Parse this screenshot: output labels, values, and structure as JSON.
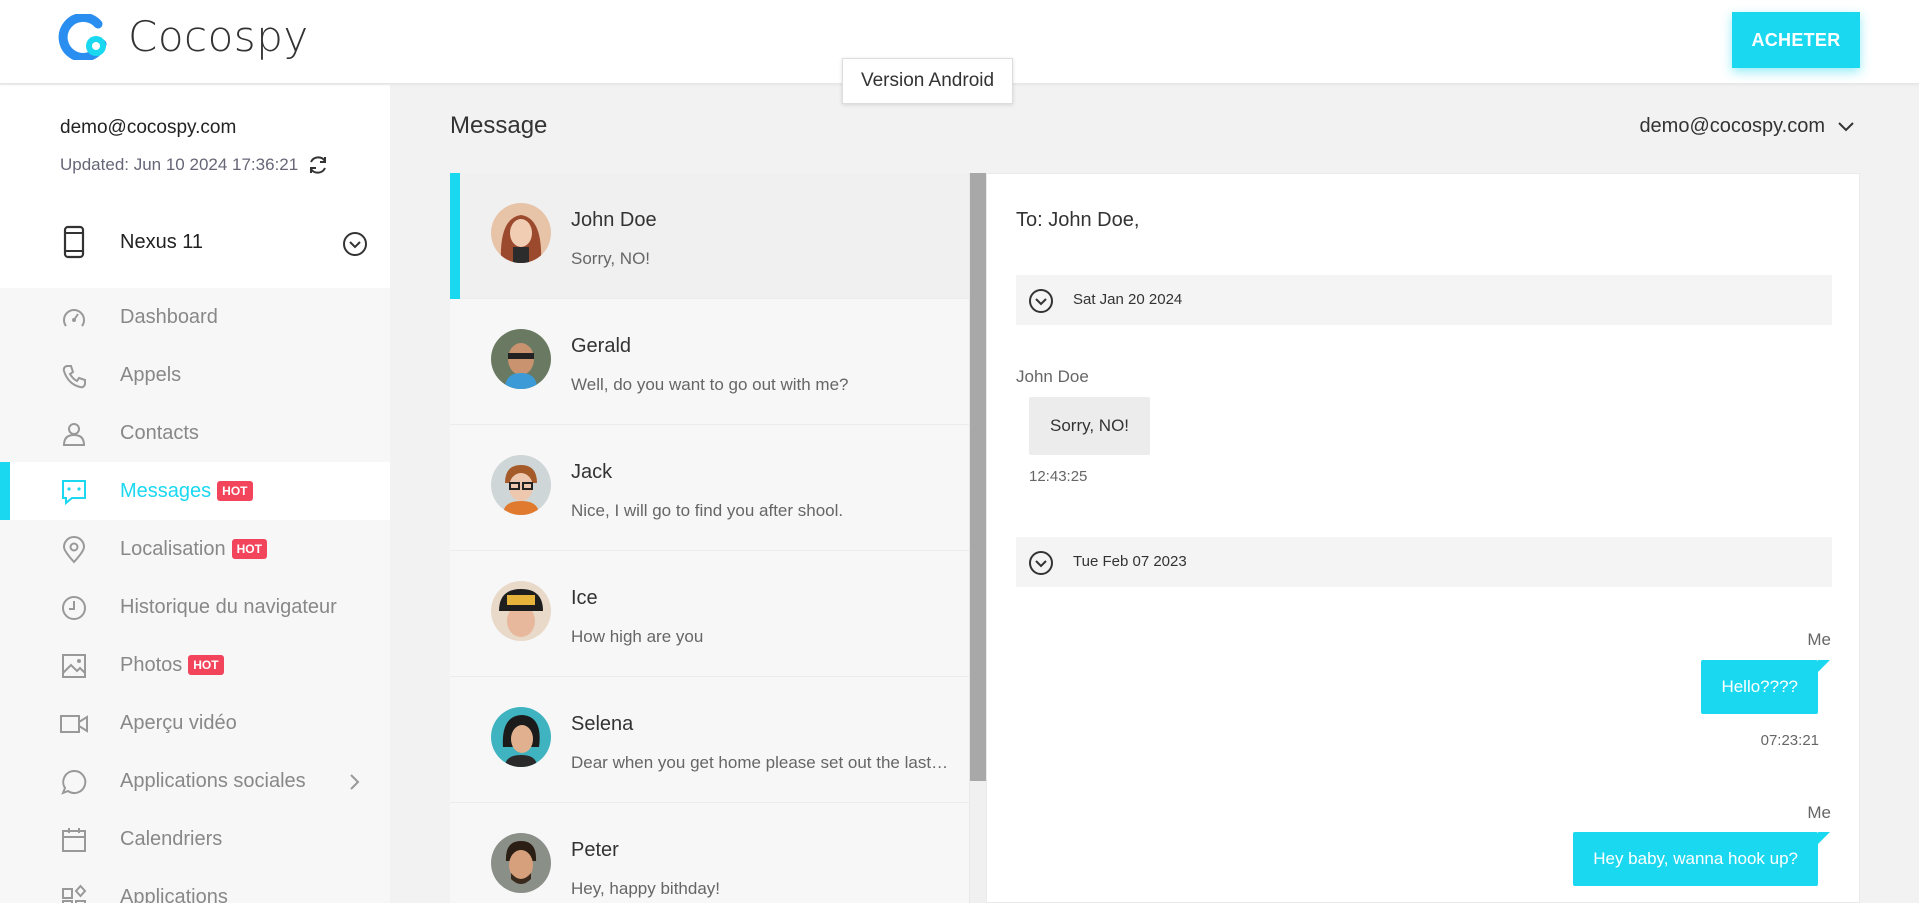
{
  "header": {
    "brand": "Cocospy",
    "buy_label": "ACHETER",
    "version_tooltip": "Version Android",
    "accent_color": "#19d8f0"
  },
  "sidebar": {
    "email": "demo@cocospy.com",
    "updated": "Updated: Jun 10 2024 17:36:21",
    "device_name": "Nexus 11",
    "items": [
      {
        "label": "Dashboard",
        "icon": "dashboard-icon",
        "hot": ""
      },
      {
        "label": "Appels",
        "icon": "phone-icon",
        "hot": ""
      },
      {
        "label": "Contacts",
        "icon": "user-icon",
        "hot": ""
      },
      {
        "label": "Messages",
        "icon": "message-icon",
        "hot": "HOT"
      },
      {
        "label": "Localisation",
        "icon": "location-icon",
        "hot": "HOT"
      },
      {
        "label": "Historique du navigateur",
        "icon": "clock-icon",
        "hot": ""
      },
      {
        "label": "Photos",
        "icon": "image-icon",
        "hot": "HOT"
      },
      {
        "label": "Aperçu vidéo",
        "icon": "video-icon",
        "hot": ""
      },
      {
        "label": "Applications sociales",
        "icon": "chat-bubble-icon",
        "hot": ""
      },
      {
        "label": "Calendriers",
        "icon": "calendar-icon",
        "hot": ""
      },
      {
        "label": "Applications",
        "icon": "apps-icon",
        "hot": ""
      }
    ]
  },
  "main": {
    "title": "Message",
    "account": "demo@cocospy.com"
  },
  "conversations": [
    {
      "name": "John Doe",
      "preview": "Sorry, NO!"
    },
    {
      "name": "Gerald",
      "preview": "Well, do you want to go out with me?"
    },
    {
      "name": "Jack",
      "preview": "Nice, I will go to find you after shool."
    },
    {
      "name": "Ice",
      "preview": "How high are you"
    },
    {
      "name": "Selena",
      "preview": "Dear when you get home please set out the last of the food"
    },
    {
      "name": "Peter",
      "preview": "Hey, happy bithday!"
    }
  ],
  "chat": {
    "to": "To: John Doe,",
    "groups": [
      {
        "date": "Sat Jan 20 2024"
      },
      {
        "date": "Tue Feb 07 2023"
      }
    ],
    "messages": [
      {
        "sender": "John Doe",
        "text": "Sorry, NO!",
        "time": "12:43:25"
      },
      {
        "sender": "Me",
        "text": "Hello????",
        "time": "07:23:21"
      },
      {
        "sender": "Me",
        "text": "Hey baby, wanna hook up?",
        "time": ""
      }
    ]
  }
}
